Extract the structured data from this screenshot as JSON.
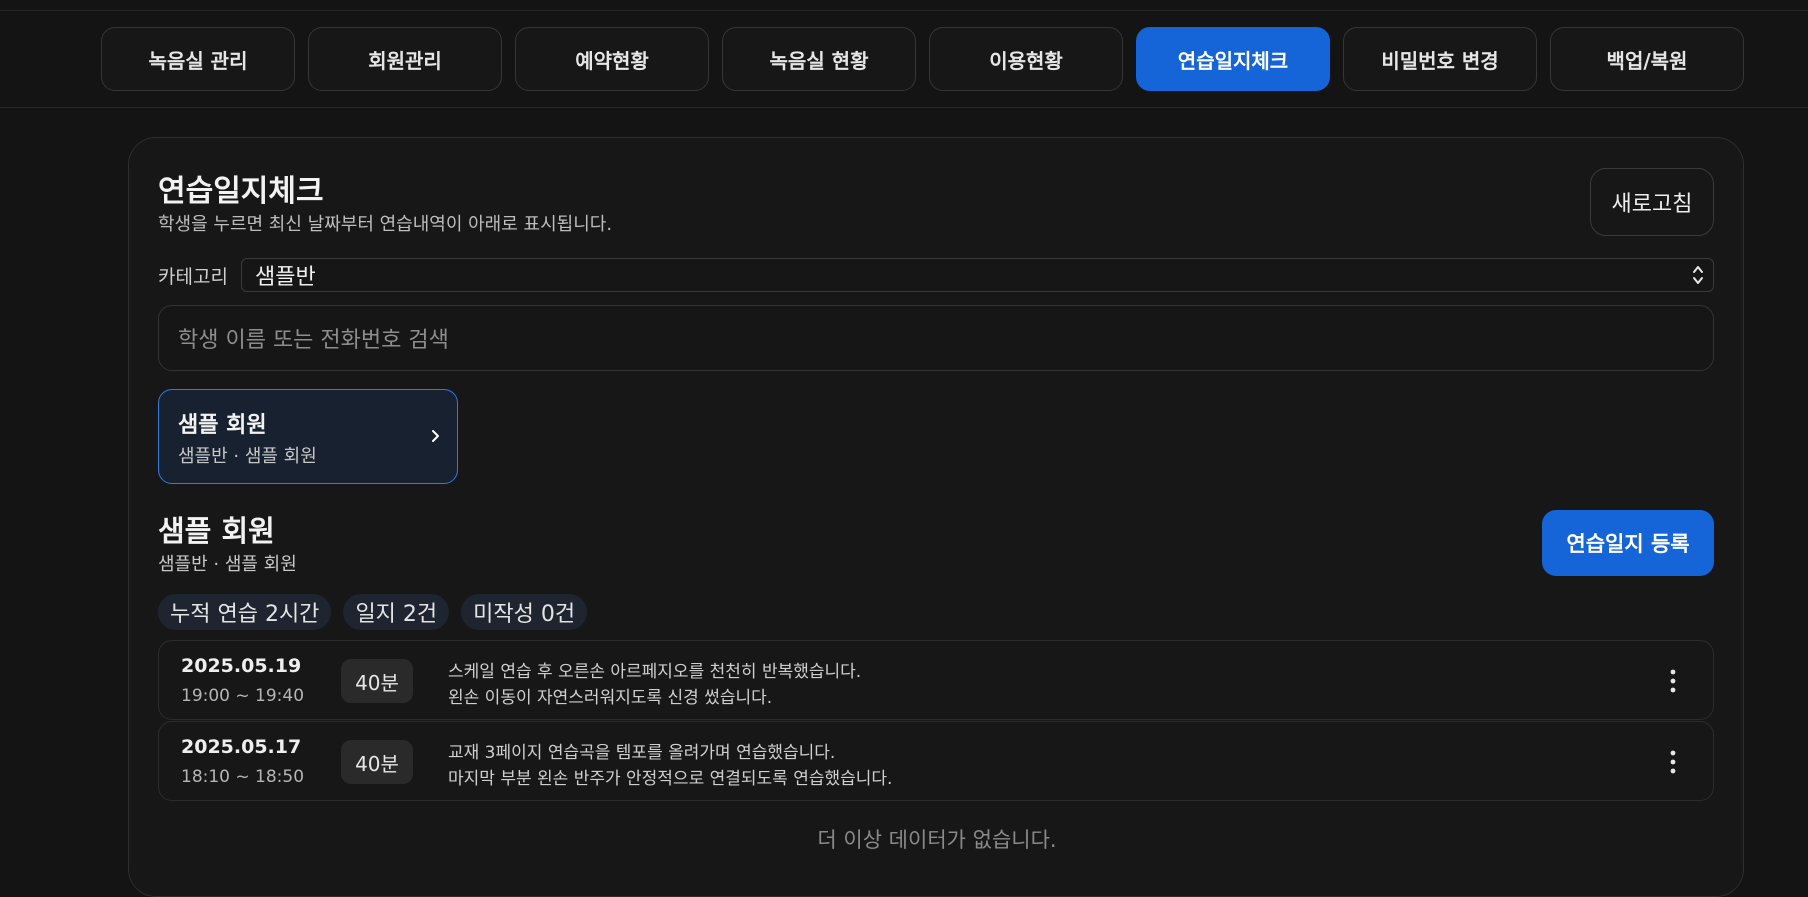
{
  "nav": {
    "tabs": [
      {
        "label": "녹음실 관리"
      },
      {
        "label": "회원관리"
      },
      {
        "label": "예약현황"
      },
      {
        "label": "녹음실 현황"
      },
      {
        "label": "이용현황"
      },
      {
        "label": "연습일지체크",
        "active": true
      },
      {
        "label": "비밀번호 변경"
      },
      {
        "label": "백업/복원"
      }
    ]
  },
  "panel": {
    "title": "연습일지체크",
    "subtitle": "학생을 누르면 최신 날짜부터 연습내역이 아래로 표시됩니다.",
    "refresh_label": "새로고침",
    "category_label": "카테고리",
    "category_value": "샘플반",
    "search_placeholder": "학생 이름 또는 전화번호 검색"
  },
  "student_card": {
    "name": "샘플 회원",
    "sub": "샘플반 · 샘플 회원"
  },
  "detail": {
    "name": "샘플 회원",
    "sub": "샘플반 · 샘플 회원",
    "register_label": "연습일지 등록",
    "chips": [
      "누적 연습 2시간",
      "일지 2건",
      "미작성 0건"
    ]
  },
  "logs": [
    {
      "date": "2025.05.19",
      "time": "19:00 ~ 19:40",
      "duration": "40분",
      "line1": "스케일 연습 후 오른손 아르페지오를 천천히 반복했습니다.",
      "line2": "왼손 이동이 자연스러워지도록 신경 썼습니다."
    },
    {
      "date": "2025.05.17",
      "time": "18:10 ~ 18:50",
      "duration": "40분",
      "line1": "교재 3페이지 연습곡을 템포를 올려가며 연습했습니다.",
      "line2": "마지막 부분 왼손 반주가 안정적으로 연결되도록 연습했습니다."
    }
  ],
  "empty_message": "더 이상 데이터가 없습니다.",
  "colors": {
    "accent": "#1565d8",
    "background": "#141414",
    "card_selected_border": "#2a7de6"
  }
}
